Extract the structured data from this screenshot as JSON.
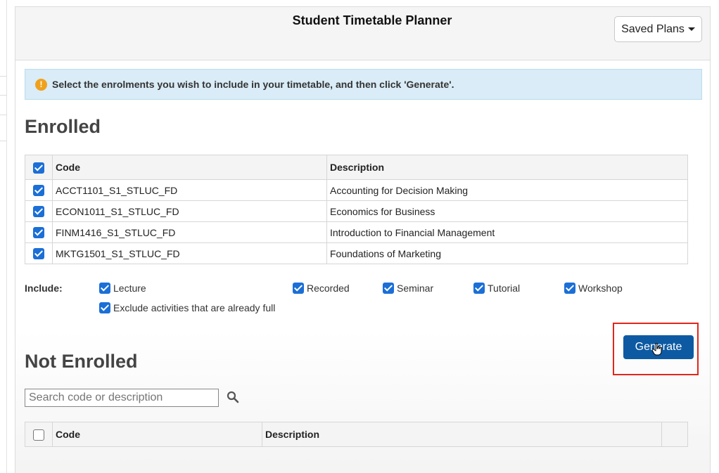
{
  "header": {
    "title": "Student Timetable Planner",
    "saved_plans_label": "Saved Plans"
  },
  "info": {
    "icon": "exclamation-circle-icon",
    "text": "Select the enrolments you wish to include in your timetable, and then click 'Generate'."
  },
  "enrolled": {
    "title": "Enrolled",
    "columns": [
      "Code",
      "Description"
    ],
    "rows": [
      {
        "code": "ACCT1101_S1_STLUC_FD",
        "description": "Accounting for Decision Making",
        "checked": true
      },
      {
        "code": "ECON1011_S1_STLUC_FD",
        "description": "Economics for Business",
        "checked": true
      },
      {
        "code": "FINM1416_S1_STLUC_FD",
        "description": "Introduction to Financial Management",
        "checked": true
      },
      {
        "code": "MKTG1501_S1_STLUC_FD",
        "description": "Foundations of Marketing",
        "checked": true
      }
    ]
  },
  "include": {
    "label": "Include:",
    "options": [
      {
        "label": "Lecture",
        "checked": true
      },
      {
        "label": "Recorded",
        "checked": true
      },
      {
        "label": "Seminar",
        "checked": true
      },
      {
        "label": "Tutorial",
        "checked": true
      },
      {
        "label": "Workshop",
        "checked": true
      },
      {
        "label": "Exclude activities that are already full",
        "checked": true
      }
    ]
  },
  "generate_label": "Generate",
  "not_enrolled": {
    "title": "Not Enrolled",
    "search_placeholder": "Search code or description",
    "columns": [
      "Code",
      "Description"
    ]
  },
  "colors": {
    "primary_button": "#0d5aa3",
    "checkbox": "#1b6fd6",
    "info_bg": "#d9ecf7",
    "highlight_frame": "#e1261c"
  }
}
